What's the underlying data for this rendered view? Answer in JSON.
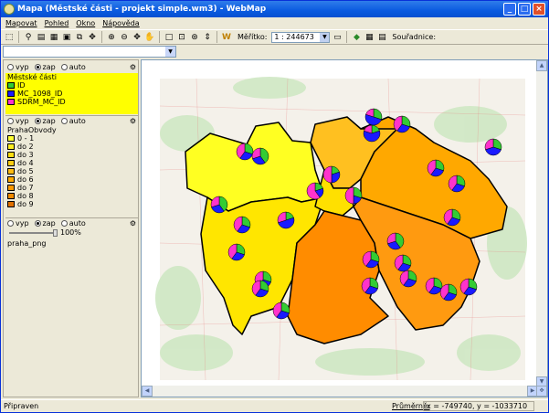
{
  "window": {
    "title": "Mapa (Městské části - projekt simple.wm3) - WebMap",
    "min": "_",
    "max": "□",
    "close": "×"
  },
  "menu": [
    "Mapovat",
    "Pohled",
    "Okno",
    "Nápověda"
  ],
  "toolbar": {
    "scale_label": "Měřítko:",
    "scale_value": "1 : 244673",
    "coords_label": "Souřadnice:"
  },
  "layers": [
    {
      "radios": [
        "vyp",
        "zap",
        "auto"
      ],
      "selected": "zap",
      "title": "Městské části",
      "items": [
        {
          "label": "ID",
          "color": "#33cc33"
        },
        {
          "label": "MC_1098_ID",
          "color": "#1a1aff"
        },
        {
          "label": "SDRM_MC_ID",
          "color": "#ff33cc"
        }
      ]
    },
    {
      "radios": [
        "vyp",
        "zap",
        "auto"
      ],
      "selected": "zap",
      "title": "PrahaObvody",
      "items": [
        {
          "label": "0 - 1",
          "color": "#ffff33"
        },
        {
          "label": "do 2",
          "color": "#ffee22"
        },
        {
          "label": "do 3",
          "color": "#ffdd11"
        },
        {
          "label": "do 4",
          "color": "#ffcc11"
        },
        {
          "label": "do 5",
          "color": "#ffbb11"
        },
        {
          "label": "do 6",
          "color": "#ffaa00"
        },
        {
          "label": "do 7",
          "color": "#ff9900"
        },
        {
          "label": "do 8",
          "color": "#f08a00"
        },
        {
          "label": "do 9",
          "color": "#e07000"
        }
      ]
    },
    {
      "radios": [
        "vyp",
        "zap",
        "auto"
      ],
      "selected": "zap",
      "opacity": "100%",
      "name": "praha_png"
    }
  ],
  "status": {
    "text": "Připraven",
    "avg_label": "Průměrně:",
    "coords": "x = -749740, y = -1033710"
  }
}
